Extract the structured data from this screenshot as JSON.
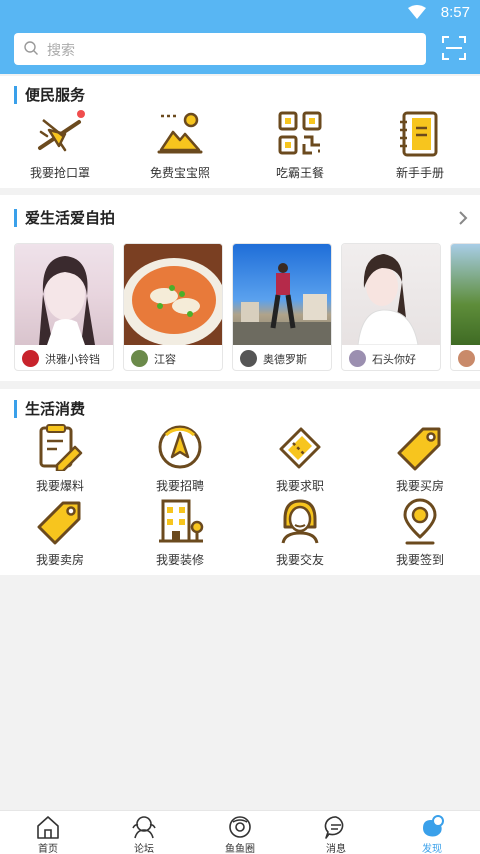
{
  "status": {
    "time": "8:57"
  },
  "search": {
    "placeholder": "搜索"
  },
  "services": {
    "title": "便民服务",
    "items": [
      {
        "label": "我要抢口罩",
        "icon": "airplane-icon"
      },
      {
        "label": "免费宝宝照",
        "icon": "photo-icon"
      },
      {
        "label": "吃霸王餐",
        "icon": "qr-code-icon"
      },
      {
        "label": "新手手册",
        "icon": "notebook-icon"
      }
    ]
  },
  "photos": {
    "title": "爱生活爱自拍",
    "cards": [
      {
        "name": "洪雅小铃铛",
        "photo": "portrait-girl"
      },
      {
        "name": "江容",
        "photo": "noodle-dish"
      },
      {
        "name": "奥德罗斯",
        "photo": "man-standing"
      },
      {
        "name": "石头你好",
        "photo": "portrait-girl-2"
      },
      {
        "name": "",
        "photo": "trees"
      }
    ]
  },
  "consumption": {
    "title": "生活消费",
    "items": [
      {
        "label": "我要爆料",
        "icon": "clipboard-pen-icon"
      },
      {
        "label": "我要招聘",
        "icon": "compass-icon"
      },
      {
        "label": "我要求职",
        "icon": "ticket-icon"
      },
      {
        "label": "我要买房",
        "icon": "tag-icon"
      },
      {
        "label": "我要卖房",
        "icon": "tag-icon"
      },
      {
        "label": "我要装修",
        "icon": "building-icon"
      },
      {
        "label": "我要交友",
        "icon": "person-icon"
      },
      {
        "label": "我要签到",
        "icon": "location-pin-icon"
      }
    ]
  },
  "nav": [
    {
      "label": "首页",
      "icon": "home-icon"
    },
    {
      "label": "论坛",
      "icon": "forum-icon"
    },
    {
      "label": "鱼鱼圈",
      "icon": "circle-icon"
    },
    {
      "label": "消息",
      "icon": "message-icon"
    },
    {
      "label": "发现",
      "icon": "discover-icon",
      "active": true
    }
  ],
  "colors": {
    "header": "#58b6f3",
    "accent": "#3aa0ea",
    "iconYellow": "#f7c51e",
    "iconBrown": "#6b4a1e"
  }
}
